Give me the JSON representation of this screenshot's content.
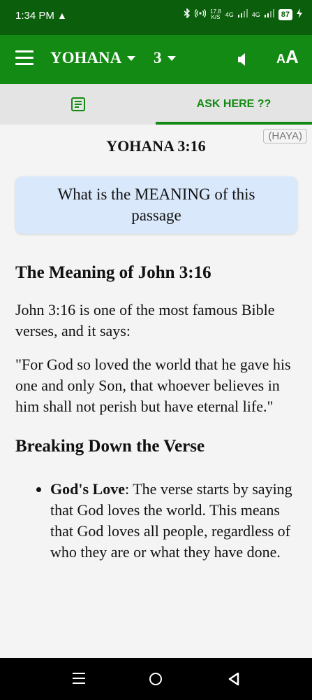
{
  "status_bar": {
    "time": "1:34 PM",
    "alert": "▲",
    "net_speed_value": "17.8",
    "net_speed_unit": "K/S",
    "sig1": "4G",
    "sig2": "4G",
    "battery": "87"
  },
  "app_bar": {
    "book": "YOHANA",
    "chapter": "3"
  },
  "tabs": {
    "right_label": "ASK HERE ??"
  },
  "content": {
    "verse_title": "YOHANA 3:16",
    "language_badge": "(HAYA)",
    "question": "What is the MEANING of this passage",
    "answer": {
      "heading": "The Meaning of John 3:16",
      "intro": "John 3:16 is one of the most famous Bible verses, and it says:",
      "quote": "\"For God so loved the world that he gave his one and only Son, that whoever believes in him shall not perish but have eternal life.\"",
      "subheading": "Breaking Down the Verse",
      "bullets": [
        {
          "term": "God's Love",
          "text": ": The verse starts by saying that God loves the world. This means that God loves all people, regardless of who they are or what they have done."
        }
      ]
    }
  },
  "colors": {
    "status_bar": "#0b5e0b",
    "app_bar": "#138a13",
    "accent": "#138a13",
    "question_card": "#d9e8fa"
  },
  "icons": {
    "menu": "hamburger-icon",
    "volume": "speaker-icon",
    "font_size": "font-size-icon",
    "notes": "document-icon"
  }
}
